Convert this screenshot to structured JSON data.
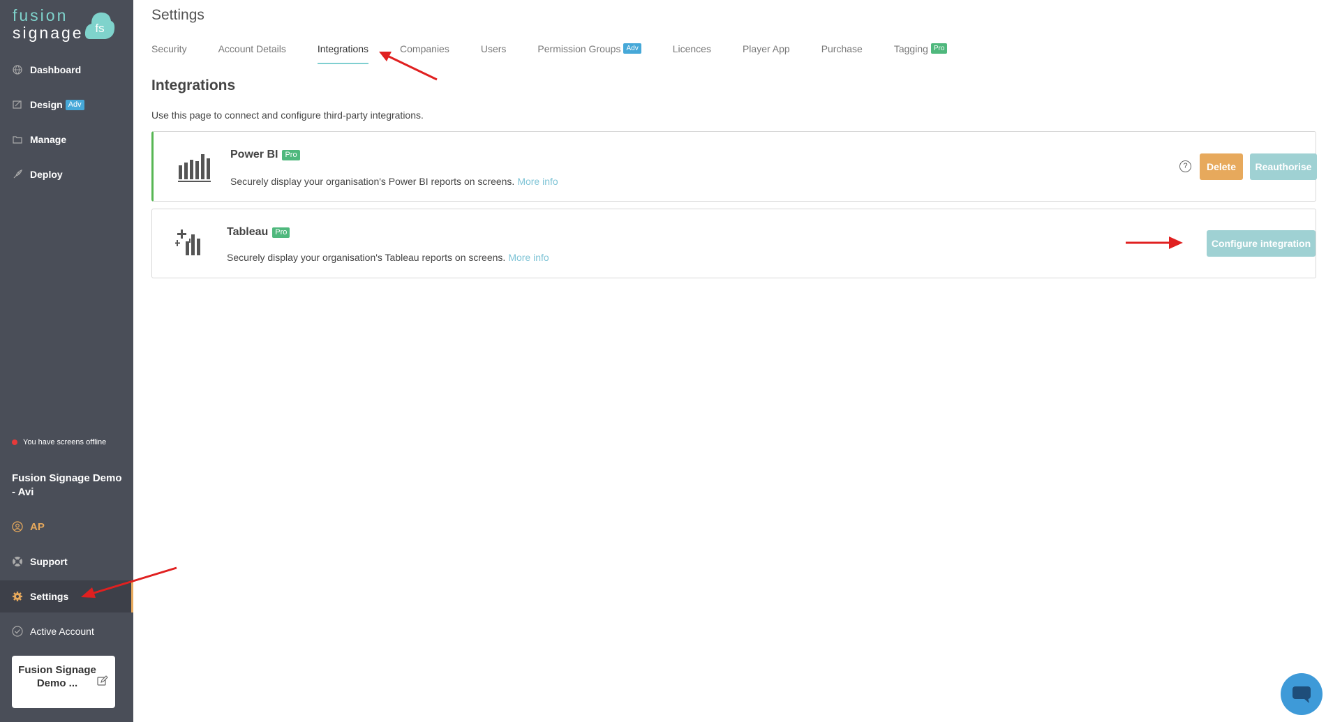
{
  "logo": {
    "line1": "fusion",
    "line2": "signage",
    "mark": "fs"
  },
  "sidebar": {
    "items": [
      {
        "label": "Dashboard",
        "icon": "globe-icon"
      },
      {
        "label": "Design",
        "badge": "Adv",
        "icon": "design-icon"
      },
      {
        "label": "Manage",
        "icon": "folder-icon"
      },
      {
        "label": "Deploy",
        "icon": "rocket-icon"
      }
    ],
    "offline_text": "You have screens offline",
    "account_name": "Fusion Signage Demo - Avi",
    "user_initials": "AP",
    "bottom_items": [
      {
        "label": "Support",
        "icon": "lifebuoy-icon"
      },
      {
        "label": "Settings",
        "icon": "gear-icon"
      },
      {
        "label": "Active Account",
        "icon": "check-circle-icon"
      }
    ],
    "account_card": {
      "label": "Fusion Signage Demo ..."
    }
  },
  "header": {
    "title": "Settings"
  },
  "tabs": [
    {
      "label": "Security"
    },
    {
      "label": "Account Details"
    },
    {
      "label": "Integrations",
      "active": true
    },
    {
      "label": "Companies"
    },
    {
      "label": "Users"
    },
    {
      "label": "Permission Groups",
      "badge": "Adv"
    },
    {
      "label": "Licences"
    },
    {
      "label": "Player App"
    },
    {
      "label": "Purchase"
    },
    {
      "label": "Tagging",
      "badge": "Pro"
    }
  ],
  "integrations": {
    "title": "Integrations",
    "description": "Use this page to connect and configure third-party integrations.",
    "powerbi": {
      "name": "Power BI",
      "badge": "Pro",
      "description": "Securely display your organisation's Power BI reports on screens.",
      "more_info": "More info",
      "help": "?",
      "delete_label": "Delete",
      "reauth_label": "Reauthorise"
    },
    "tableau": {
      "name": "Tableau",
      "badge": "Pro",
      "description": "Securely display your organisation's Tableau reports on screens.",
      "more_info": "More info",
      "configure_label": "Configure integration"
    }
  },
  "colors": {
    "sidebar_bg": "#4a4e58",
    "accent_teal": "#7fd3cc",
    "orange": "#e7a95c",
    "button_teal": "#9fd1d3",
    "pro_green": "#4fb87d",
    "adv_blue": "#46a8d8",
    "active_border": "#57b653"
  }
}
